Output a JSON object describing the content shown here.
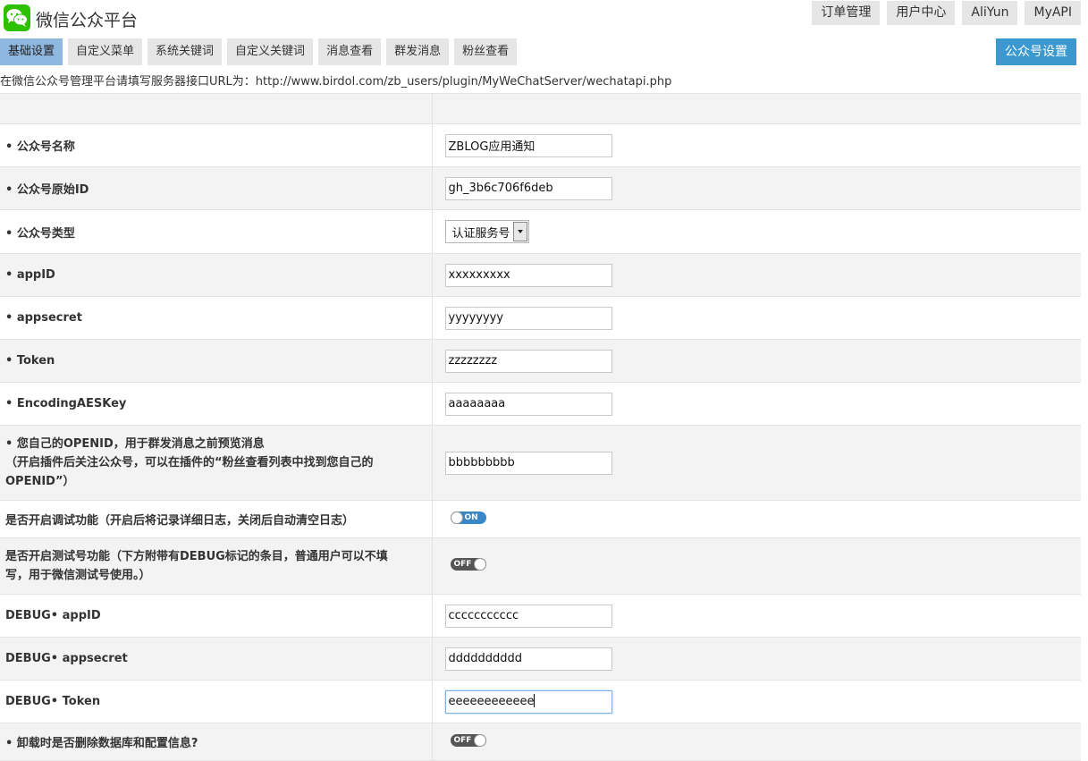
{
  "app": {
    "title": "微信公众平台",
    "brand_color": "#2dc100"
  },
  "top_nav": [
    "订单管理",
    "用户中心",
    "AliYun",
    "MyAPI"
  ],
  "tabs": [
    {
      "label": "基础设置",
      "active": true
    },
    {
      "label": "自定义菜单",
      "active": false
    },
    {
      "label": "系统关键词",
      "active": false
    },
    {
      "label": "自定义关键词",
      "active": false
    },
    {
      "label": "消息查看",
      "active": false
    },
    {
      "label": "群发消息",
      "active": false
    },
    {
      "label": "粉丝查看",
      "active": false
    }
  ],
  "settings_button": "公众号设置",
  "url_note": "在微信公众号管理平台请填写服务器接口URL为：http://www.birdol.com/zb_users/plugin/MyWeChatServer/wechatapi.php",
  "form": {
    "account_name": {
      "label": "• 公众号名称",
      "value": "ZBLOG应用通知"
    },
    "original_id": {
      "label": "• 公众号原始ID",
      "value": "gh_3b6c706f6deb"
    },
    "account_type": {
      "label": "• 公众号类型",
      "value": "认证服务号"
    },
    "app_id": {
      "label": "• appID",
      "value": "xxxxxxxxx"
    },
    "app_secret": {
      "label": "• appsecret",
      "value": "yyyyyyyy"
    },
    "token": {
      "label": "• Token",
      "value": "zzzzzzzz"
    },
    "aes_key": {
      "label": "• EncodingAESKey",
      "value": "aaaaaaaa"
    },
    "openid": {
      "label_line1": "• 您自己的OPENID，用于群发消息之前预览消息",
      "label_line2": "（开启插件后关注公众号，可以在插件的“粉丝查看列表中找到您自己的",
      "label_line3": "OPENID”）",
      "value": "bbbbbbbbb"
    },
    "debug_log": {
      "label": "是否开启调试功能（开启后将记录详细日志，关闭后自动清空日志）",
      "state": "ON"
    },
    "debug_mode": {
      "label_line1": "是否开启测试号功能（下方附带有DEBUG标记的条目，普通用户可以不填",
      "label_line2": "写，用于微信测试号使用。）",
      "state": "OFF"
    },
    "debug_app_id": {
      "label": "DEBUG• appID",
      "value": "ccccccccccc"
    },
    "debug_app_secret": {
      "label": "DEBUG• appsecret",
      "value": "dddddddddd"
    },
    "debug_token": {
      "label": "DEBUG• Token",
      "value": "eeeeeeeeeeee"
    },
    "uninstall_delete": {
      "label": "• 卸载时是否删除数据库和配置信息?",
      "state": "OFF"
    }
  },
  "icons": {
    "logo": "wechat-logo-icon",
    "select_arrow": "chevron-down-icon"
  }
}
